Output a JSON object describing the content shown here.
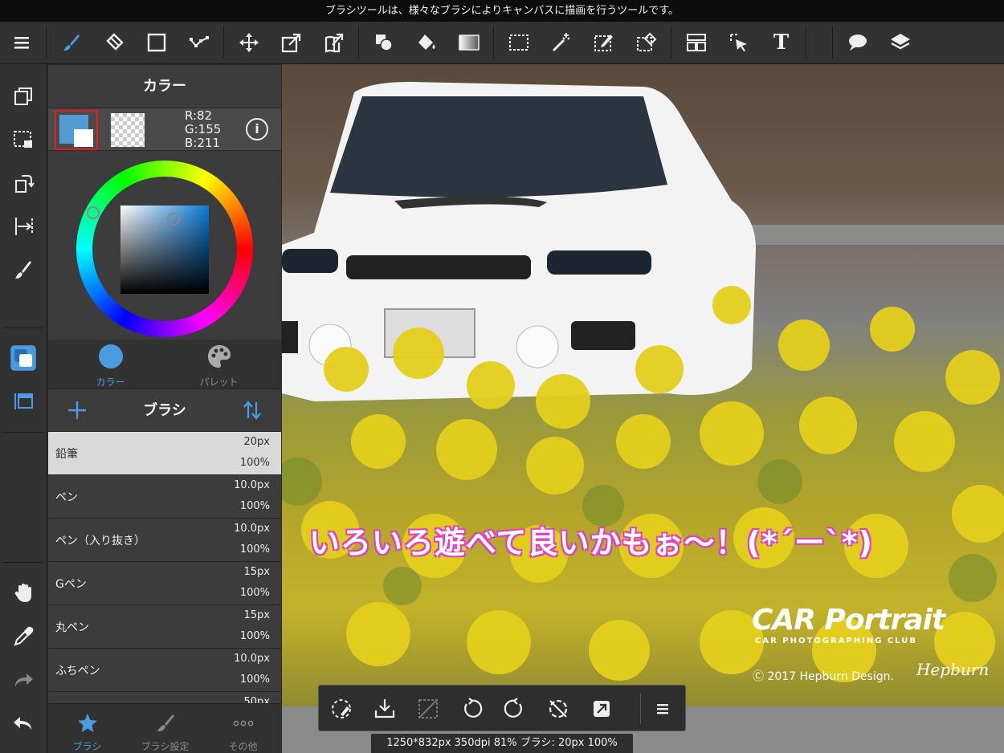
{
  "tooltip": "ブラシツールは、様々なブラシによりキャンバスに描画を行うツールです。",
  "toolbar": {
    "text_tool_glyph": "T"
  },
  "color_panel": {
    "title": "カラー",
    "foreground_color": "#529bd3",
    "rgb": {
      "r": "R:82",
      "g": "G:155",
      "b": "B:211"
    },
    "info_glyph": "i",
    "tabs": [
      {
        "label": "カラー",
        "icon": "circle-icon",
        "active": true
      },
      {
        "label": "パレット",
        "icon": "palette-icon",
        "active": false
      }
    ]
  },
  "brush_panel": {
    "title": "ブラシ",
    "brushes": [
      {
        "name": "鉛筆",
        "size": "20px",
        "opacity": "100%",
        "selected": true
      },
      {
        "name": "ペン",
        "size": "10.0px",
        "opacity": "100%"
      },
      {
        "name": "ペン（入り抜き）",
        "size": "10.0px",
        "opacity": "100%"
      },
      {
        "name": "Gペン",
        "size": "15px",
        "opacity": "100%"
      },
      {
        "name": "丸ペン",
        "size": "15px",
        "opacity": "100%"
      },
      {
        "name": "ふちペン",
        "size": "10.0px",
        "opacity": "100%"
      },
      {
        "name": "",
        "size": "50px",
        "opacity": ""
      }
    ],
    "tabs": [
      {
        "label": "ブラシ",
        "icon": "star-icon",
        "active": true
      },
      {
        "label": "ブラシ設定",
        "icon": "brush-settings-icon",
        "active": false
      },
      {
        "label": "その他",
        "icon": "more-icon",
        "active": false
      }
    ]
  },
  "canvas": {
    "overlay_text": "いろいろ遊べて良いかもぉ～！(*´ー`*)",
    "logo_text": "CAR Portrait",
    "logo_subtext": "CAR PHOTOGRAPHING CLUB",
    "copyright_text": "Ⓒ 2017 Hepburn Design.",
    "signature_text": "Hepburn"
  },
  "status": "1250*832px 350dpi 81% ブラシ: 20px 100%",
  "colors": {
    "accent": "#4a9be0",
    "selection_border": "#e02020"
  }
}
